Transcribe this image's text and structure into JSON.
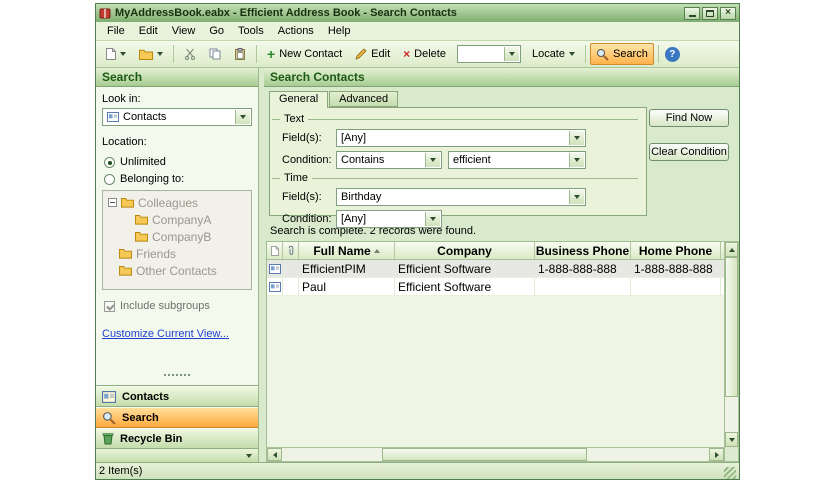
{
  "window": {
    "title": "MyAddressBook.eabx - Efficient Address Book - Search Contacts"
  },
  "icons": {
    "close_glyph": "×",
    "delete_glyph": "×",
    "plus_glyph": "+",
    "help_glyph": "?"
  },
  "menubar": {
    "items": [
      "File",
      "Edit",
      "View",
      "Go",
      "Tools",
      "Actions",
      "Help"
    ]
  },
  "toolbar": {
    "new_contact": "New Contact",
    "edit": "Edit",
    "delete": "Delete",
    "quick_search_value": "",
    "locate": "Locate",
    "search": "Search"
  },
  "sidebar": {
    "header": "Search",
    "look_in_label": "Look in:",
    "look_in_value": "Contacts",
    "location_label": "Location:",
    "unlimited": "Unlimited",
    "belonging_to": "Belonging to:",
    "tree": {
      "items": [
        {
          "label": "Colleagues"
        },
        {
          "label": "CompanyA"
        },
        {
          "label": "CompanyB"
        },
        {
          "label": "Friends"
        },
        {
          "label": "Other Contacts"
        }
      ]
    },
    "include_subgroups": "Include subgroups",
    "customize_link": "Customize Current View...",
    "nav": {
      "contacts": "Contacts",
      "search": "Search",
      "recycle_bin": "Recycle Bin"
    }
  },
  "main": {
    "header": "Search Contacts",
    "tabs": {
      "general": "General",
      "advanced": "Advanced"
    },
    "text_group": {
      "title": "Text",
      "fields_label": "Field(s):",
      "fields_value": "[Any]",
      "condition_label": "Condition:",
      "condition_value": "Contains",
      "keyword_value": "efficient"
    },
    "time_group": {
      "title": "Time",
      "fields_label": "Field(s):",
      "fields_value": "Birthday",
      "condition_label": "Condition:",
      "condition_value": "[Any]"
    },
    "buttons": {
      "find_now": "Find Now",
      "clear_condition": "Clear Condition"
    },
    "result_status": "Search is complete. 2 records were found.",
    "table": {
      "columns": {
        "full_name": "Full Name",
        "company": "Company",
        "business_phone": "Business Phone",
        "home_phone": "Home Phone"
      },
      "rows": [
        {
          "full_name": "EfficientPIM",
          "company": "Efficient Software",
          "business_phone": "1-888-888-888",
          "home_phone": "1-888-888-888"
        },
        {
          "full_name": "Paul",
          "company": "Efficient Software",
          "business_phone": "",
          "home_phone": ""
        }
      ]
    }
  },
  "statusbar": {
    "items": "2 Item(s)"
  }
}
